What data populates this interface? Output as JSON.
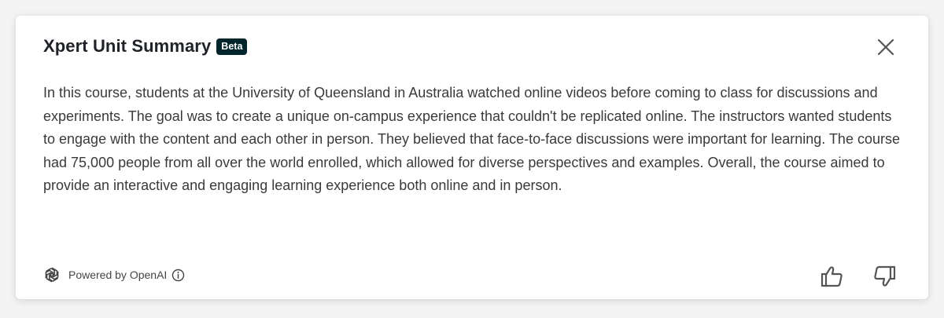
{
  "header": {
    "title": "Xpert Unit Summary",
    "badge": "Beta",
    "close_icon": "close-icon"
  },
  "summary": {
    "text": "In this course, students at the University of Queensland in Australia watched online videos before coming to class for discussions and experiments. The goal was to create a unique on-campus experience that couldn't be replicated online. The instructors wanted students to engage with the content and each other in person. They believed that face-to-face discussions were important for learning. The course had 75,000 people from all over the world enrolled, which allowed for diverse perspectives and examples. Overall, the course aimed to provide an interactive and engaging learning experience both online and in person."
  },
  "footer": {
    "powered_by": "Powered by OpenAI",
    "logo_icon": "openai-logo-icon",
    "info_icon": "info-icon",
    "thumbs_up_icon": "thumbs-up-icon",
    "thumbs_down_icon": "thumbs-down-icon"
  },
  "colors": {
    "badge_bg": "#00262b",
    "text": "#3a3a3a",
    "title": "#1f2328",
    "icon": "#555555"
  }
}
